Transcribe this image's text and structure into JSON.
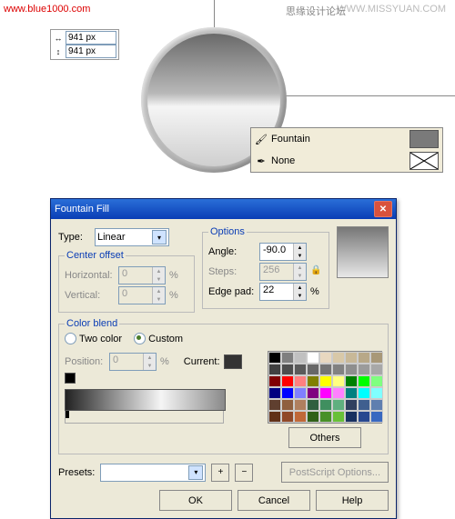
{
  "watermarks": {
    "left": "www.blue1000.com",
    "right": "WWW.MISSYUAN.COM",
    "mid": "思缘设计论坛"
  },
  "size_box": {
    "w": "941 px",
    "h": "941 px"
  },
  "fill_popup": {
    "fill_label": "Fountain",
    "outline_label": "None",
    "swatch_color": "#7a7a7a"
  },
  "dialog": {
    "title": "Fountain Fill",
    "type_label": "Type:",
    "type_value": "Linear",
    "center_offset_group": "Center offset",
    "horizontal_label": "Horizontal:",
    "horizontal_value": "0",
    "vertical_label": "Vertical:",
    "vertical_value": "0",
    "options_group": "Options",
    "angle_label": "Angle:",
    "angle_value": "-90.0",
    "steps_label": "Steps:",
    "steps_value": "256",
    "edgepad_label": "Edge pad:",
    "edgepad_value": "22",
    "percent": "%",
    "colorblend_group": "Color blend",
    "two_color": "Two color",
    "custom": "Custom",
    "position_label": "Position:",
    "position_value": "0",
    "current_label": "Current:",
    "others": "Others",
    "presets_label": "Presets:",
    "postscript": "PostScript Options...",
    "ok": "OK",
    "cancel": "Cancel",
    "help": "Help"
  },
  "palette_colors": [
    "#000000",
    "#7f7f7f",
    "#c0c0c0",
    "#ffffff",
    "#e8d8c0",
    "#d8c8a8",
    "#c8b898",
    "#b8a888",
    "#a89878",
    "#404040",
    "#4d4d4d",
    "#5a5a5a",
    "#676767",
    "#747474",
    "#818181",
    "#8e8e8e",
    "#9b9b9b",
    "#a8a8a8",
    "#800000",
    "#ff0000",
    "#ff8080",
    "#808000",
    "#ffff00",
    "#ffff80",
    "#008000",
    "#00ff00",
    "#80ff80",
    "#000080",
    "#0000ff",
    "#8080ff",
    "#800080",
    "#ff00ff",
    "#ff80ff",
    "#008080",
    "#00ffff",
    "#80ffff",
    "#5f3f2f",
    "#8f5f3f",
    "#af7f5f",
    "#2f5f3f",
    "#3f8f5f",
    "#5faf7f",
    "#2f3f5f",
    "#3f5f8f",
    "#5f7faf",
    "#603018",
    "#904828",
    "#c06838",
    "#306018",
    "#489028",
    "#68c038",
    "#183060",
    "#284890",
    "#3868c0"
  ]
}
